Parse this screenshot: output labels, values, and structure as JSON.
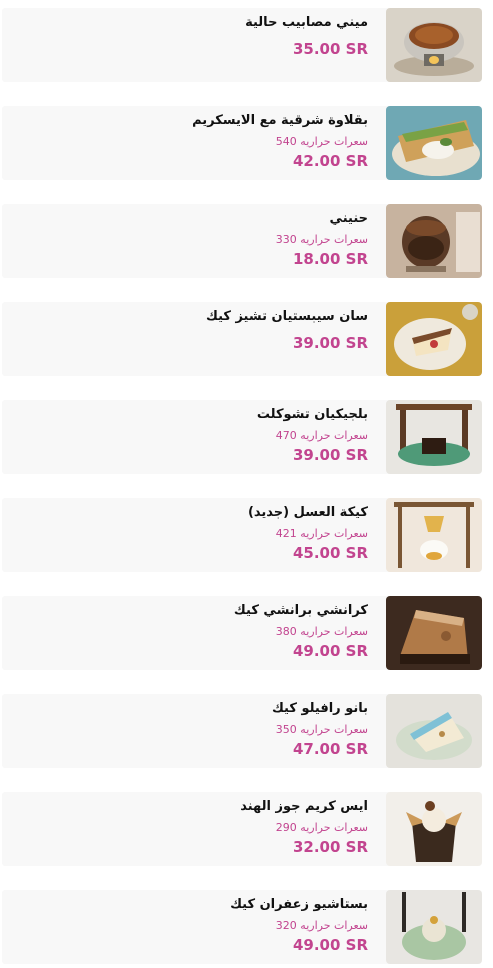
{
  "currency": "SR",
  "calories_label": "سعرات حراريه",
  "colors": {
    "price": "#c2448f",
    "calories": "#c2448f",
    "name": "#111111",
    "card_background": "#f8f8f8",
    "page_background": "#ffffff"
  },
  "items": [
    {
      "name": "ميني مصابيب حالية",
      "calories": "",
      "price": "35.00 SR",
      "photo": "pudding-candle-bowl"
    },
    {
      "name": "بقلاوة شرقية مع الايسكريم",
      "calories": "540",
      "price": "42.00 SR",
      "photo": "baklava-icecream"
    },
    {
      "name": "حنيني",
      "calories": "330",
      "price": "18.00 SR",
      "photo": "chocolate-jar"
    },
    {
      "name": "سان سيبستيان تشيز كيك",
      "calories": "",
      "price": "39.00 SR",
      "photo": "cheesecake-slice"
    },
    {
      "name": "بلجيكيان تشوكلت",
      "calories": "470",
      "price": "39.00 SR",
      "photo": "chocolate-cube-stand"
    },
    {
      "name": "كيكة العسل (جديد)",
      "calories": "421",
      "price": "45.00 SR",
      "photo": "honey-cake-swing"
    },
    {
      "name": "كرانشي برانشي كيك",
      "calories": "380",
      "price": "49.00 SR",
      "photo": "crunchy-cake-slice"
    },
    {
      "name": "بانو رافيلو كيك",
      "calories": "350",
      "price": "47.00 SR",
      "photo": "raffaello-cake"
    },
    {
      "name": "ايس كريم جوز الهند",
      "calories": "290",
      "price": "32.00 SR",
      "photo": "coconut-icecream-box"
    },
    {
      "name": "بستاشيو زعفران كيك",
      "calories": "320",
      "price": "49.00 SR",
      "photo": "pistachio-saffron-cake"
    }
  ]
}
